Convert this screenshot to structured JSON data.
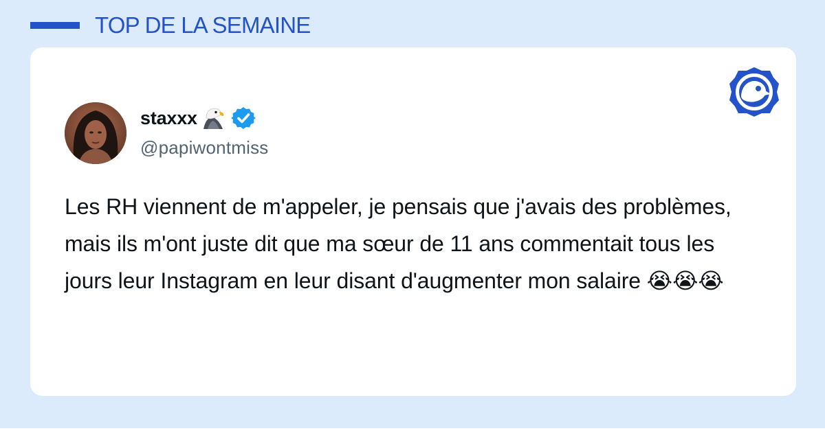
{
  "header": {
    "title": "TOP DE LA SEMAINE"
  },
  "tweet": {
    "display_name": "staxxx",
    "name_emoji_icon": "eagle-icon",
    "verified_icon": "verified-badge-icon",
    "handle": "@papiwontmiss",
    "text": "Les RH viennent de m'appeler, je pensais que j'avais des problèmes, mais ils m'ont juste dit que ma sœur de 11 ans commentait tous les jours leur Instagram en leur disant d'augmenter mon salaire",
    "emojis": "😭😭😭"
  },
  "brand": {
    "logo_icon": "bird-badge-icon"
  },
  "colors": {
    "background": "#dcebfb",
    "accent": "#2453c9",
    "verified": "#1d9bf0",
    "text": "#0f1419",
    "handle": "#536471",
    "card": "#ffffff"
  }
}
